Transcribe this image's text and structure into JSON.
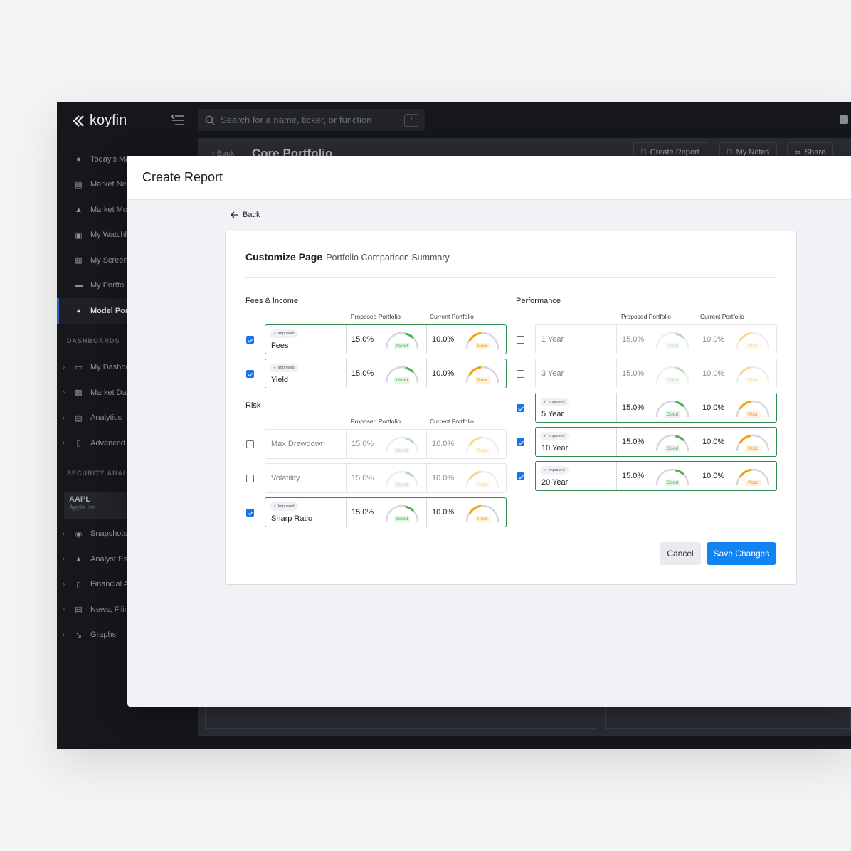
{
  "app": {
    "logo_text": "koyfin",
    "search_placeholder": "Search for a name, ticker, or function",
    "search_shortcut": "/",
    "page_back": "Back",
    "page_title": "Core Portfolio",
    "header_buttons": [
      "Create Report",
      "My Notes",
      "Share"
    ],
    "nav_top": [
      {
        "label": "Today's Ma",
        "icon": "globe-icon"
      },
      {
        "label": "Market Ne",
        "icon": "newspaper-icon"
      },
      {
        "label": "Market Mo",
        "icon": "flame-icon"
      },
      {
        "label": "My Watchl",
        "icon": "watchlist-icon"
      },
      {
        "label": "My Screen",
        "icon": "screener-icon"
      },
      {
        "label": "My Portfol",
        "icon": "wallet-icon"
      },
      {
        "label": "Model Por",
        "icon": "pie-chart-icon",
        "active": true
      }
    ],
    "dashboards_label": "DASHBOARDS",
    "nav_dashboards": [
      {
        "label": "My Dashbo",
        "icon": "monitor-icon"
      },
      {
        "label": "Market Da",
        "icon": "grid-icon"
      },
      {
        "label": "Analytics",
        "icon": "analytics-icon"
      },
      {
        "label": "Advanced",
        "icon": "document-icon"
      }
    ],
    "security_label": "SECURITY ANALY",
    "ticker": {
      "symbol": "AAPL",
      "name": "Apple Inc."
    },
    "nav_security": [
      {
        "label": "Snapshots",
        "icon": "camera-icon"
      },
      {
        "label": "Analyst Es",
        "icon": "analyst-icon"
      },
      {
        "label": "Financial A",
        "icon": "financial-icon"
      },
      {
        "label": "News, Filin",
        "icon": "newspaper-icon"
      },
      {
        "label": "Graphs",
        "icon": "graph-icon"
      }
    ]
  },
  "modal": {
    "title": "Create Report",
    "back_label": "Back",
    "card_title": "Customize Page",
    "card_subtitle": "Portfolio Comparison Summary",
    "col_proposed": "Proposed Portfolio",
    "col_current": "Current Portfolio",
    "badge_text": "Improved",
    "good_label": "Good",
    "poor_label": "Poor",
    "sections": [
      {
        "title": "Fees & Income",
        "rows": [
          {
            "name": "Fees",
            "checked": true,
            "proposed": "15.0%",
            "current": "10.0%"
          },
          {
            "name": "Yield",
            "checked": true,
            "proposed": "15.0%",
            "current": "10.0%"
          }
        ]
      },
      {
        "title": "Risk",
        "rows": [
          {
            "name": "Max Drawdown",
            "checked": false,
            "proposed": "15.0%",
            "current": "10.0%"
          },
          {
            "name": "Volatility",
            "checked": false,
            "proposed": "15.0%",
            "current": "10.0%"
          },
          {
            "name": "Sharp Ratio",
            "checked": true,
            "proposed": "15.0%",
            "current": "10.0%"
          }
        ]
      },
      {
        "title": "Performance",
        "rows": [
          {
            "name": "1 Year",
            "checked": false,
            "proposed": "15.0%",
            "current": "10.0%"
          },
          {
            "name": "3 Year",
            "checked": false,
            "proposed": "15.0%",
            "current": "10.0%"
          },
          {
            "name": "5 Year",
            "checked": true,
            "proposed": "15.0%",
            "current": "10.0%"
          },
          {
            "name": "10 Year",
            "checked": true,
            "proposed": "15.0%",
            "current": "10.0%"
          },
          {
            "name": "20 Year",
            "checked": true,
            "proposed": "15.0%",
            "current": "10.0%"
          }
        ]
      }
    ],
    "cancel_label": "Cancel",
    "save_label": "Save Changes",
    "colors": {
      "good": "#4caf50",
      "poor": "#f5a000",
      "accent": "#1183f2",
      "selected_border": "#2e8a4a"
    }
  }
}
